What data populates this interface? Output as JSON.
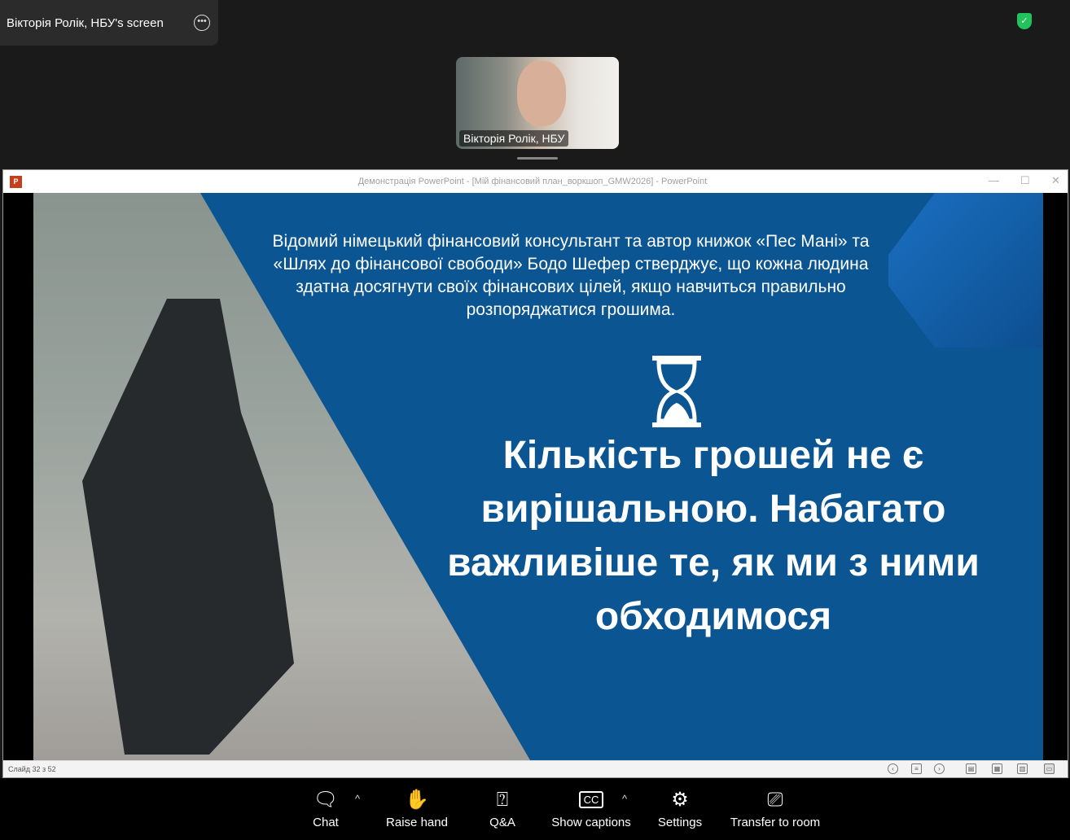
{
  "topbar": {
    "share_label": "Вікторія Ролік, НБУ's screen"
  },
  "video": {
    "name": "Вікторія Ролік, НБУ"
  },
  "powerpoint": {
    "window_title": "Демонстрація PowerPoint - [Мій фінансовий план_воркшоп_GMW2026] - PowerPoint",
    "logo": "P",
    "slide": {
      "quote": "Відомий німецький фінансовий консультант та автор книжок «Пес Мані» та «Шлях до фінансової свободи» Бодо Шефер стверджує, що кожна людина здатна досягнути своїх фінансових цілей, якщо навчиться правильно розпоряджатися грошима.",
      "headline": "Кількість грошей не є вирішальною. Набагато важливіше те, як ми з ними обходимося"
    },
    "status": "Слайд 32 з 52"
  },
  "toolbar": {
    "chat": "Chat",
    "raise_hand": "Raise hand",
    "qa": "Q&A",
    "captions": "Show captions",
    "settings": "Settings",
    "transfer": "Transfer to room"
  },
  "colors": {
    "slide_bg": "#0a5592",
    "secure": "#21c35c"
  }
}
